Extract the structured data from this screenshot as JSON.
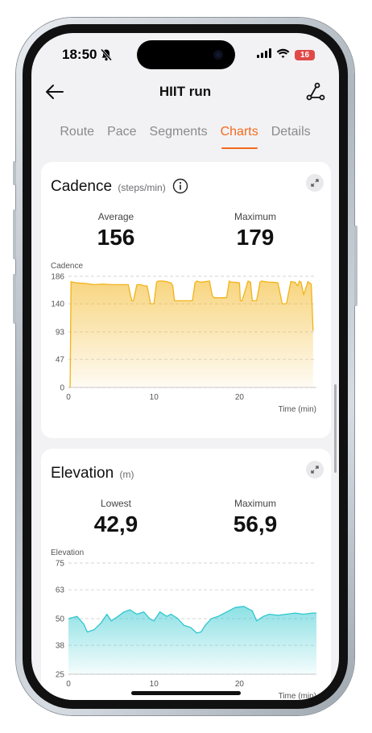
{
  "status": {
    "time": "18:50",
    "battery": "16"
  },
  "header": {
    "title": "HIIT run"
  },
  "tabs": [
    {
      "label": "Route"
    },
    {
      "label": "Pace"
    },
    {
      "label": "Segments"
    },
    {
      "label": "Charts",
      "active": true
    },
    {
      "label": "Details"
    }
  ],
  "cadence": {
    "title": "Cadence",
    "unit": "(steps/min)",
    "average_label": "Average",
    "average_value": "156",
    "max_label": "Maximum",
    "max_value": "179"
  },
  "elevation": {
    "title": "Elevation",
    "unit": "(m)",
    "lowest_label": "Lowest",
    "lowest_value": "42,9",
    "max_label": "Maximum",
    "max_value": "56,9"
  },
  "colors": {
    "accent": "#f26b1d",
    "cadence_line": "#f2b318",
    "elevation_line": "#2ec7cf"
  },
  "chart_data": [
    {
      "type": "area",
      "ylabel": "Cadence",
      "xlabel": "Time (min)",
      "x_ticks": [
        0,
        10,
        20
      ],
      "y_ticks": [
        0,
        47,
        93,
        140,
        186
      ],
      "xlim": [
        0,
        29
      ],
      "ylim": [
        0,
        186
      ],
      "series": [
        {
          "x": [
            0,
            0.2,
            0.3,
            1,
            2,
            3,
            4,
            5,
            6,
            7,
            7.4,
            7.6,
            8,
            8.4,
            8.9,
            9.2,
            9.6,
            10,
            10.3,
            10.5,
            11,
            11.5,
            12,
            12.2,
            12.4,
            13,
            14,
            14.5,
            14.8,
            15,
            15.5,
            16,
            16.5,
            16.8,
            17,
            18,
            18.5,
            18.8,
            19,
            19.5,
            20,
            20.1,
            20.3,
            21,
            21.3,
            21.5,
            22,
            22.4,
            22.6,
            23,
            23.5,
            24,
            24.5,
            25,
            25.5,
            26,
            26.5,
            26.8,
            27,
            27.2,
            27.5,
            28,
            28.4,
            28.6
          ],
          "y": [
            0,
            0,
            177,
            175,
            174,
            172,
            173,
            172,
            172,
            172,
            145,
            145,
            172,
            172,
            170,
            170,
            140,
            140,
            176,
            178,
            178,
            177,
            175,
            170,
            145,
            145,
            145,
            145,
            175,
            178,
            176,
            177,
            178,
            155,
            150,
            150,
            150,
            178,
            176,
            176,
            175,
            145,
            145,
            178,
            176,
            145,
            145,
            176,
            178,
            177,
            176,
            176,
            175,
            140,
            140,
            177,
            176,
            170,
            178,
            176,
            155,
            177,
            173,
            95
          ]
        }
      ]
    },
    {
      "type": "area",
      "ylabel": "Elevation",
      "xlabel": "Time (min)",
      "x_ticks": [
        0,
        10,
        20
      ],
      "y_ticks": [
        25,
        38,
        50,
        63,
        75
      ],
      "xlim": [
        0,
        29
      ],
      "ylim": [
        25,
        75
      ],
      "series": [
        {
          "x": [
            0,
            1,
            1.8,
            2.2,
            3,
            3.8,
            4.5,
            5,
            5.8,
            6.5,
            7.2,
            8,
            8.8,
            9.5,
            10,
            10.7,
            11.5,
            12,
            12.8,
            13.5,
            14.3,
            15,
            15.5,
            16,
            16.7,
            17.5,
            18.5,
            19.5,
            20.5,
            21.5,
            22,
            22.8,
            23.5,
            24.5,
            25.5,
            26.5,
            27.5,
            28.5,
            29
          ],
          "y": [
            50,
            51,
            47.5,
            44,
            45,
            48,
            52,
            49,
            51,
            53,
            54,
            52,
            53,
            50,
            49,
            53,
            51,
            52,
            50,
            47,
            46,
            43.5,
            44,
            47,
            50,
            51,
            53,
            55,
            55.5,
            53.5,
            49,
            51,
            52,
            51.5,
            52,
            52.5,
            52,
            52.5,
            52.5
          ]
        }
      ]
    }
  ]
}
